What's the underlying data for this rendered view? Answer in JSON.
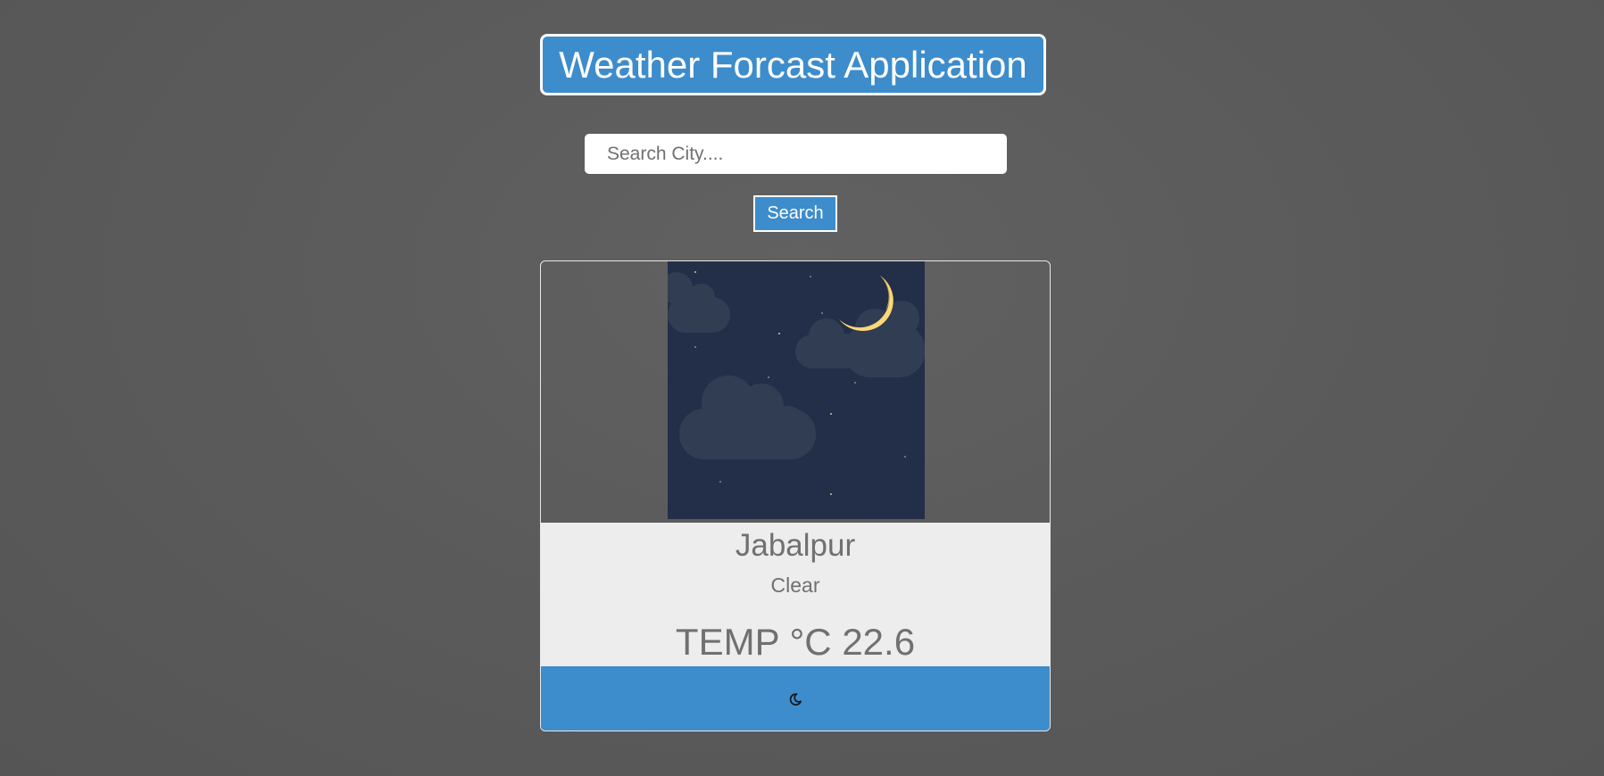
{
  "header": {
    "title": "Weather Forcast Application"
  },
  "search": {
    "placeholder": "Search City....",
    "value": "",
    "button_label": "Search"
  },
  "weather": {
    "image_icon": "night-clear-moon-clouds-illustration",
    "city": "Jabalpur",
    "condition": "Clear",
    "temp_label": "TEMP °C",
    "temp_value": "22.6",
    "footer_icon": "moon-icon"
  },
  "colors": {
    "accent": "#3d8ccc",
    "background": "#5a5a5a",
    "info_panel": "#ededed",
    "text_muted": "#707070",
    "night_sky": "#232f48",
    "moon": "#fbd878"
  }
}
